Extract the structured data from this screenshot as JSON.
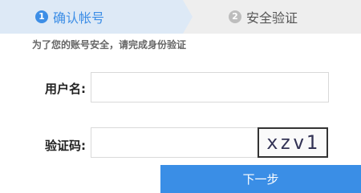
{
  "steps": [
    {
      "number": "1",
      "label": "确认帐号"
    },
    {
      "number": "2",
      "label": "安全验证"
    }
  ],
  "hint": "为了您的账号安全，请完成身份验证",
  "form": {
    "username_label": "用户名:",
    "username_value": "",
    "captcha_label": "验证码:",
    "captcha_value": "",
    "captcha_image_text": "xzv1"
  },
  "next_button": "下一步",
  "colors": {
    "accent": "#3a8ee6",
    "step_bar_bg": "#eeeeee",
    "active_step_bg": "#dde9f6"
  }
}
